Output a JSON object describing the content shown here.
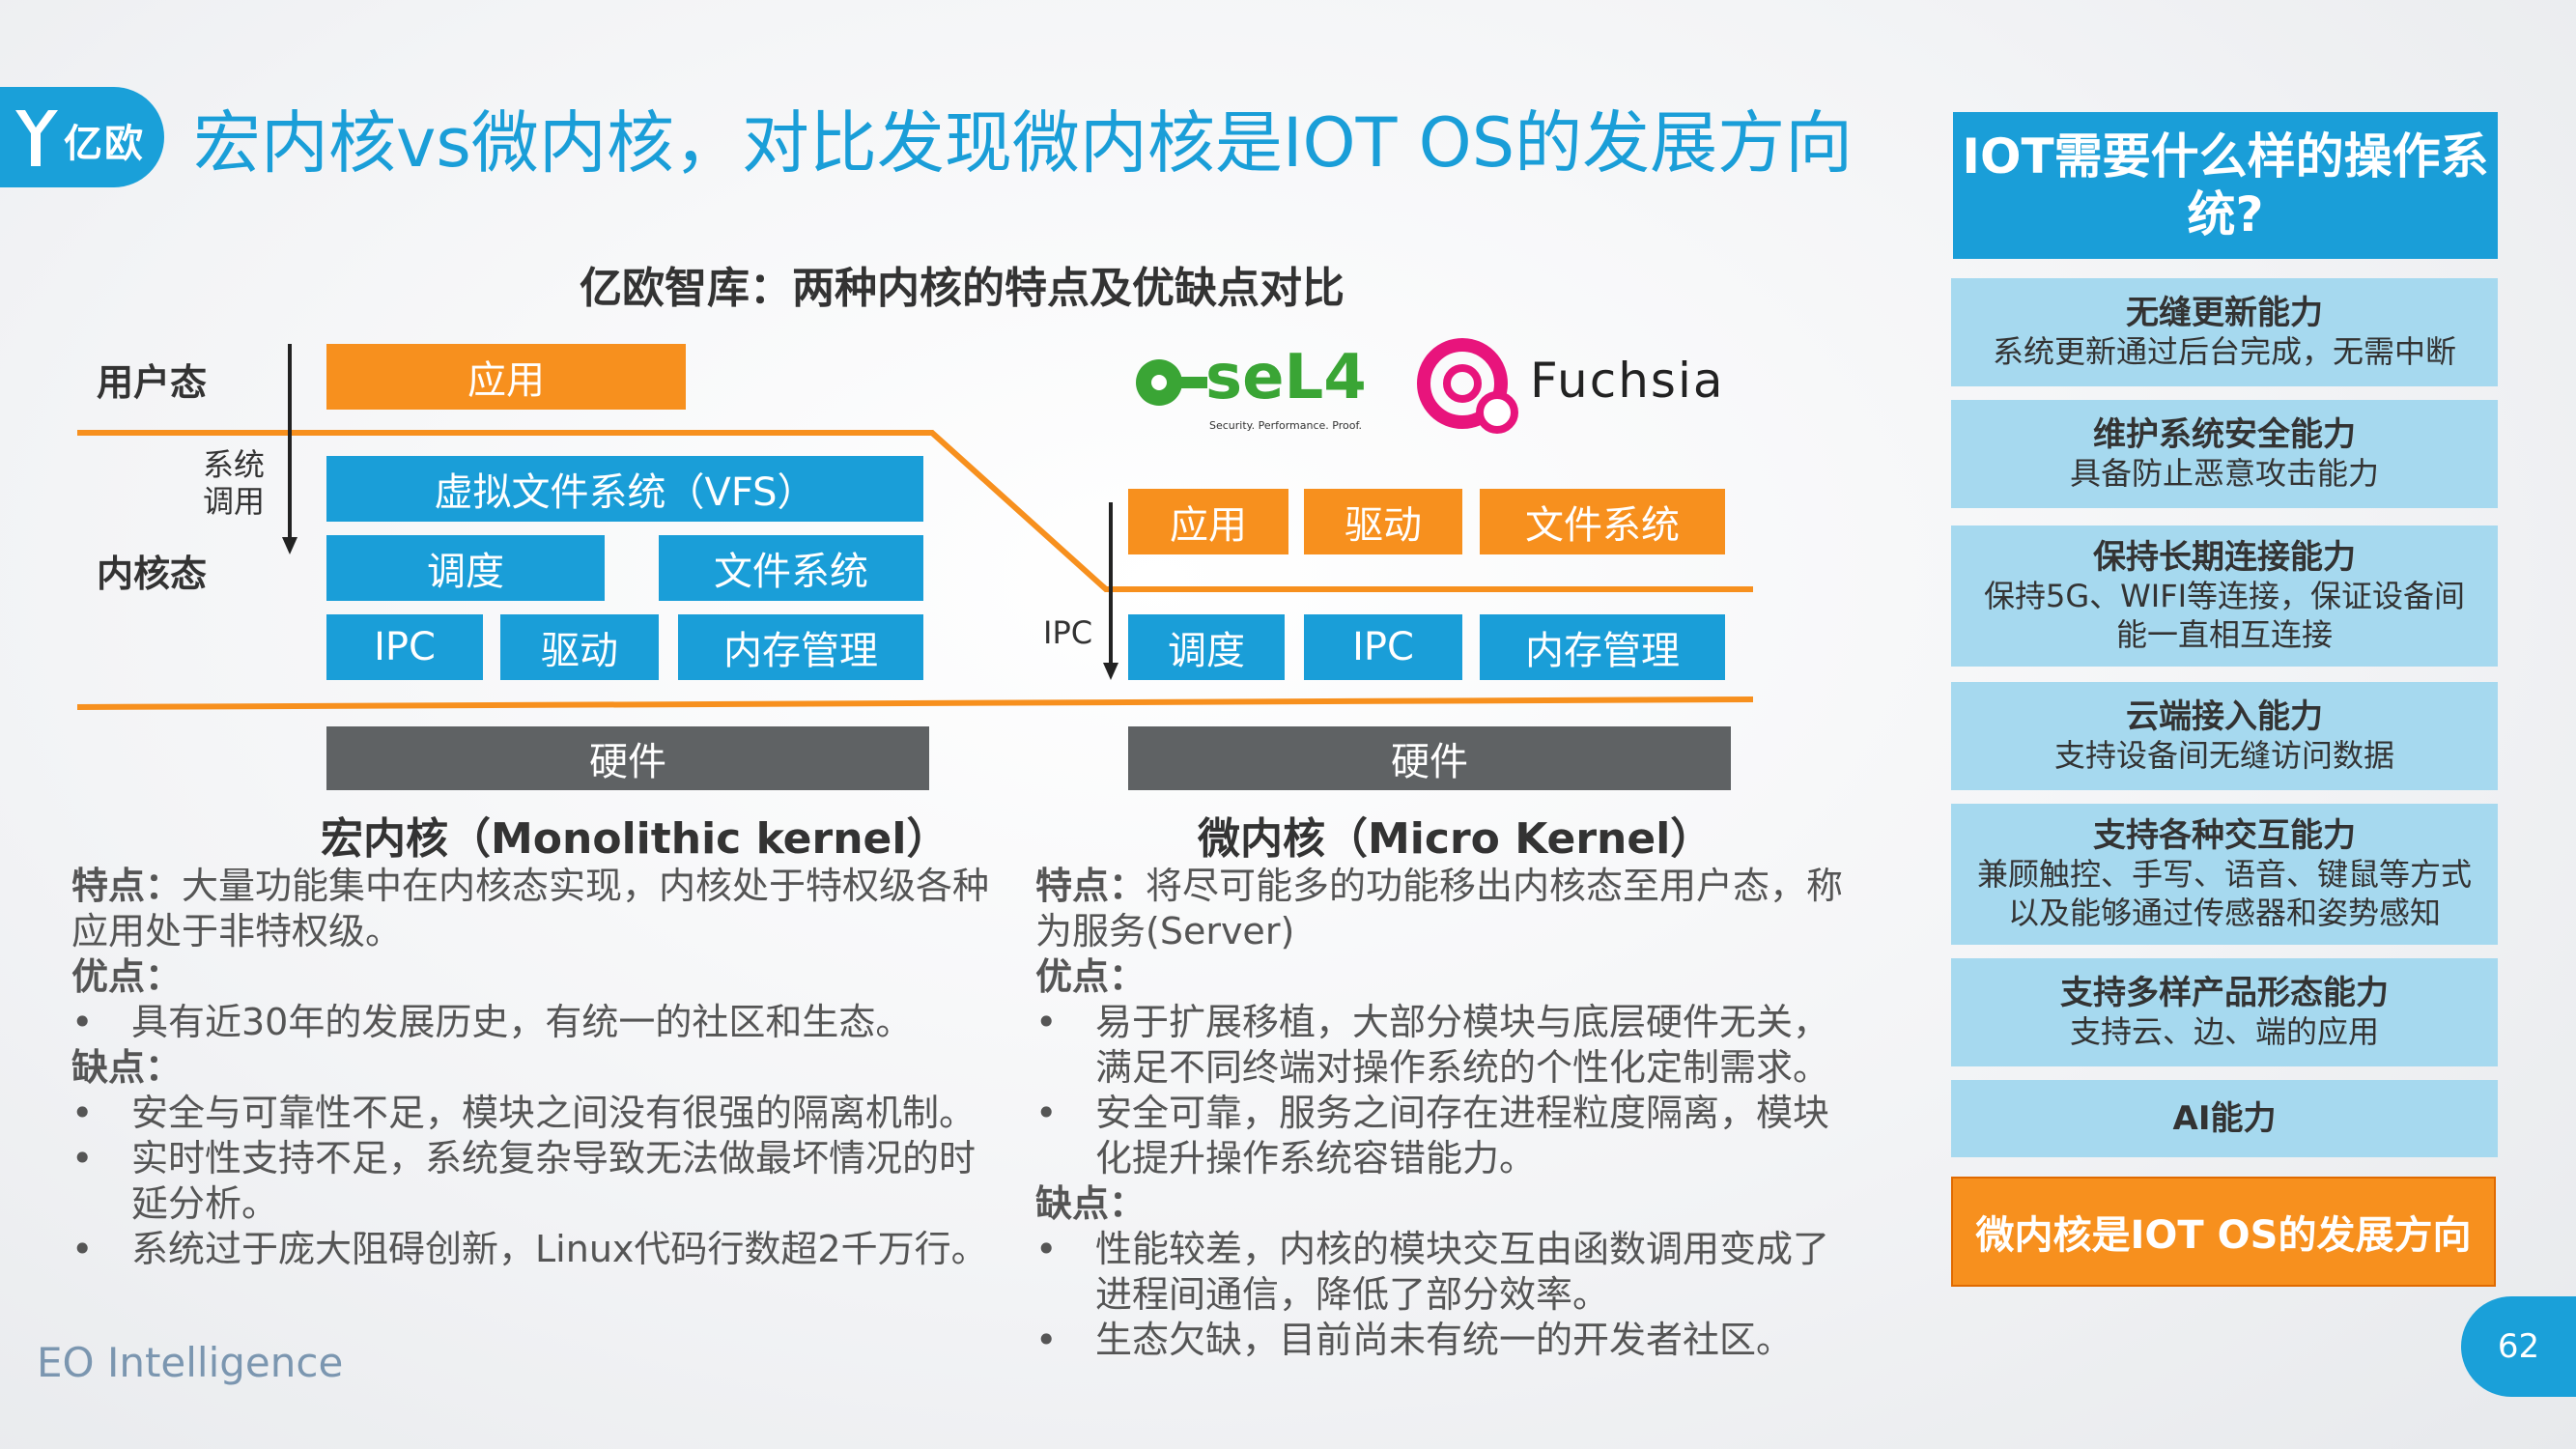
{
  "header": {
    "logo_text": "亿欧",
    "title": "宏内核vs微内核，对比发现微内核是IOT OS的发展方向",
    "subtitle": "亿欧智库：两种内核的特点及优缺点对比"
  },
  "diagram": {
    "user_mode_label": "用户态",
    "syscall_label": "系统\n调用",
    "kernel_mode_label": "内核态",
    "ipc_label": "IPC",
    "mono": {
      "app": "应用",
      "vfs": "虚拟文件系统（VFS）",
      "sched": "调度",
      "fs": "文件系统",
      "ipc": "IPC",
      "driver": "驱动",
      "mem": "内存管理",
      "hw": "硬件",
      "title": "宏内核（Monolithic kernel）"
    },
    "micro": {
      "app": "应用",
      "driver": "驱动",
      "fs": "文件系统",
      "sched": "调度",
      "ipc": "IPC",
      "mem": "内存管理",
      "hw": "硬件",
      "title": "微内核（Micro Kernel）"
    },
    "sel4_text": "seL4",
    "sel4_tagline": "Security. Performance. Proof.",
    "fuchsia_text": "Fuchsia"
  },
  "mono_text": {
    "feature_label": "特点：",
    "feature_text": "大量功能集中在内核态实现，内核处于特权级各种应用处于非特权级。",
    "pros_label": "优点：",
    "pros": [
      "具有近30年的发展历史，有统一的社区和生态。"
    ],
    "cons_label": "缺点：",
    "cons": [
      "安全与可靠性不足，模块之间没有很强的隔离机制。",
      "实时性支持不足，系统复杂导致无法做最坏情况的时延分析。",
      "系统过于庞大阻碍创新，Linux代码行数超2千万行。"
    ]
  },
  "micro_text": {
    "feature_label": "特点：",
    "feature_text": "将尽可能多的功能移出内核态至用户态，称为服务(Server)",
    "pros_label": "优点：",
    "pros": [
      "易于扩展移植，大部分模块与底层硬件无关，满足不同终端对操作系统的个性化定制需求。",
      "安全可靠，服务之间存在进程粒度隔离，模块化提升操作系统容错能力。"
    ],
    "cons_label": "缺点：",
    "cons": [
      "性能较差，内核的模块交互由函数调用变成了进程间通信，降低了部分效率。",
      "生态欠缺，目前尚未有统一的开发者社区。"
    ]
  },
  "right_panel": {
    "heading": "IOT需要什么样的操作系统?",
    "items": [
      {
        "title": "无缝更新能力",
        "desc": "系统更新通过后台完成，无需中断"
      },
      {
        "title": "维护系统安全能力",
        "desc": "具备防止恶意攻击能力"
      },
      {
        "title": "保持长期连接能力",
        "desc": "保持5G、WIFI等连接，保证设备间能一直相互连接"
      },
      {
        "title": "云端接入能力",
        "desc": "支持设备间无缝访问数据"
      },
      {
        "title": "支持各种交互能力",
        "desc": "兼顾触控、手写、语音、键鼠等方式以及能够通过传感器和姿势感知"
      },
      {
        "title": "支持多样产品形态能力",
        "desc": "支持云、边、端的应用"
      },
      {
        "title": "AI能力",
        "desc": ""
      }
    ],
    "conclusion": "微内核是IOT OS的发展方向"
  },
  "footer": {
    "brand": "EO Intelligence",
    "page": "62"
  },
  "colors": {
    "blue": "#1a9ed8",
    "orange": "#f7901e",
    "gray": "#5f6264",
    "light_blue": "#a6d9ef"
  }
}
